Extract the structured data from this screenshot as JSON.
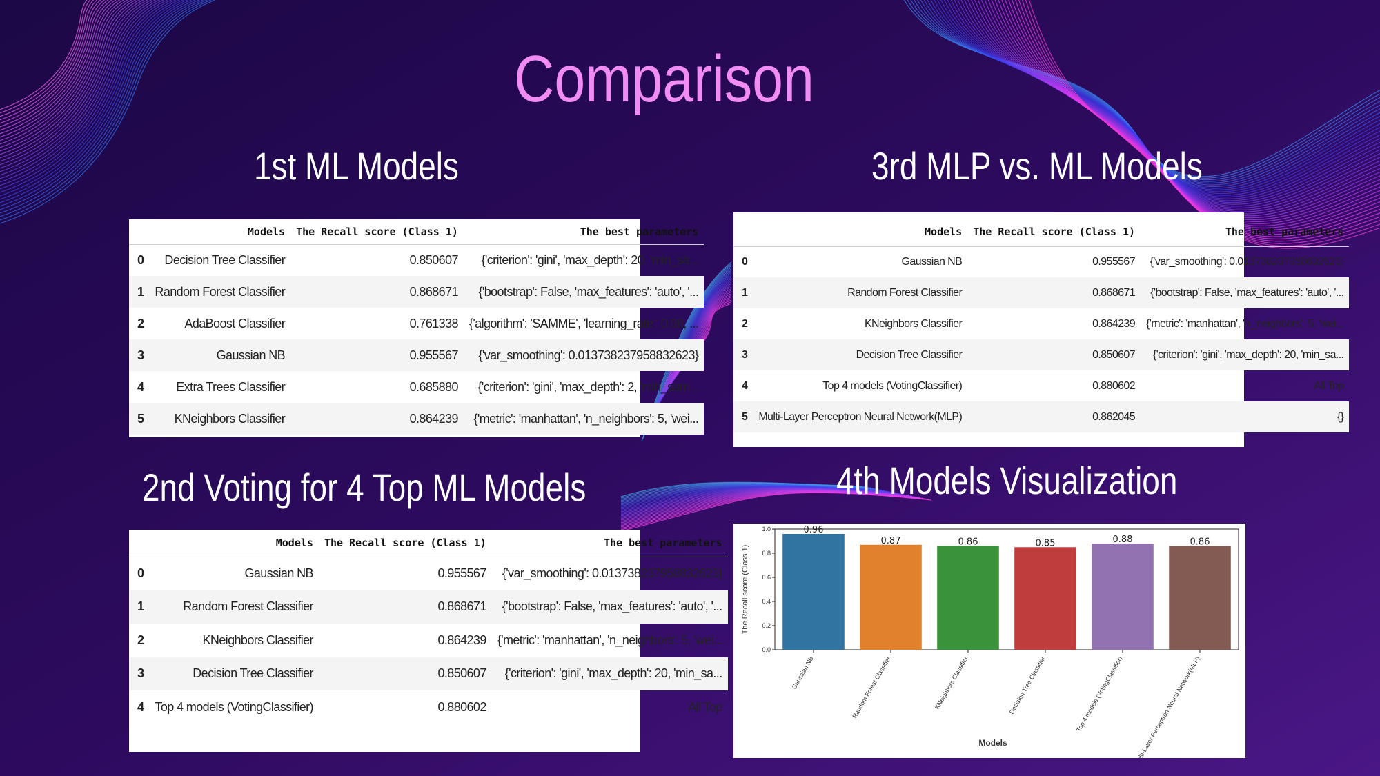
{
  "slide": {
    "title": "Comparison",
    "sections": {
      "s1": "1st ML Models",
      "s2": "2nd Voting for 4 Top ML Models",
      "s3": "3rd MLP vs. ML Models",
      "s4": "4th Models Visualization"
    }
  },
  "tables": {
    "headers": [
      "Models",
      "The Recall score (Class 1)",
      "The best parameters"
    ],
    "t1": [
      [
        "0",
        "Decision Tree Classifier",
        "0.850607",
        "{'criterion': 'gini', 'max_depth': 20, 'min_sa..."
      ],
      [
        "1",
        "Random Forest Classifier",
        "0.868671",
        "{'bootstrap': False, 'max_features': 'auto', '..."
      ],
      [
        "2",
        "AdaBoost Classifier",
        "0.761338",
        "{'algorithm': 'SAMME', 'learning_rate': 0.98, ..."
      ],
      [
        "3",
        "Gaussian NB",
        "0.955567",
        "{'var_smoothing': 0.013738237958832623}"
      ],
      [
        "4",
        "Extra Trees Classifier",
        "0.685880",
        "{'criterion': 'gini', 'max_depth': 2, 'min_sam..."
      ],
      [
        "5",
        "KNeighbors Classifier",
        "0.864239",
        "{'metric': 'manhattan', 'n_neighbors': 5, 'wei..."
      ]
    ],
    "t2": [
      [
        "0",
        "Gaussian NB",
        "0.955567",
        "{'var_smoothing': 0.013738237958832623}"
      ],
      [
        "1",
        "Random Forest Classifier",
        "0.868671",
        "{'bootstrap': False, 'max_features': 'auto', '..."
      ],
      [
        "2",
        "KNeighbors Classifier",
        "0.864239",
        "{'metric': 'manhattan', 'n_neighbors': 5, 'wei..."
      ],
      [
        "3",
        "Decision Tree Classifier",
        "0.850607",
        "{'criterion': 'gini', 'max_depth': 20, 'min_sa..."
      ],
      [
        "4",
        "Top 4 models (VotingClassifier)",
        "0.880602",
        "All Top"
      ]
    ],
    "t3": [
      [
        "0",
        "Gaussian NB",
        "0.955567",
        "{'var_smoothing': 0.013738237958832623}"
      ],
      [
        "1",
        "Random Forest Classifier",
        "0.868671",
        "{'bootstrap': False, 'max_features': 'auto', '..."
      ],
      [
        "2",
        "KNeighbors Classifier",
        "0.864239",
        "{'metric': 'manhattan', 'n_neighbors': 5, 'wei..."
      ],
      [
        "3",
        "Decision Tree Classifier",
        "0.850607",
        "{'criterion': 'gini', 'max_depth': 20, 'min_sa..."
      ],
      [
        "4",
        "Top 4 models (VotingClassifier)",
        "0.880602",
        "All Top"
      ],
      [
        "5",
        "Multi-Layer Perceptron Neural Network(MLP)",
        "0.862045",
        "{}"
      ]
    ]
  },
  "chart_data": {
    "type": "bar",
    "categories": [
      "Gaussian NB",
      "Random Forest Classifier",
      "KNeighbors Classifier",
      "Decision Tree Classifier",
      "Top 4 models (VotingClassifier)",
      "Multi-Layer Perceptron Neural Network(MLP)"
    ],
    "values": [
      0.96,
      0.87,
      0.86,
      0.85,
      0.88,
      0.86
    ],
    "data_labels": [
      "0.96",
      "0.87",
      "0.86",
      "0.85",
      "0.88",
      "0.86"
    ],
    "colors": [
      "#3274a1",
      "#e1812c",
      "#3a923a",
      "#c03d3e",
      "#9372b2",
      "#845b53"
    ],
    "xlabel": "Models",
    "ylabel": "The Recall score (Class 1)",
    "ylim": [
      0,
      1.0
    ],
    "yticks": [
      "0.0",
      "0.2",
      "0.4",
      "0.6",
      "0.8",
      "1.0"
    ],
    "grid": false
  }
}
